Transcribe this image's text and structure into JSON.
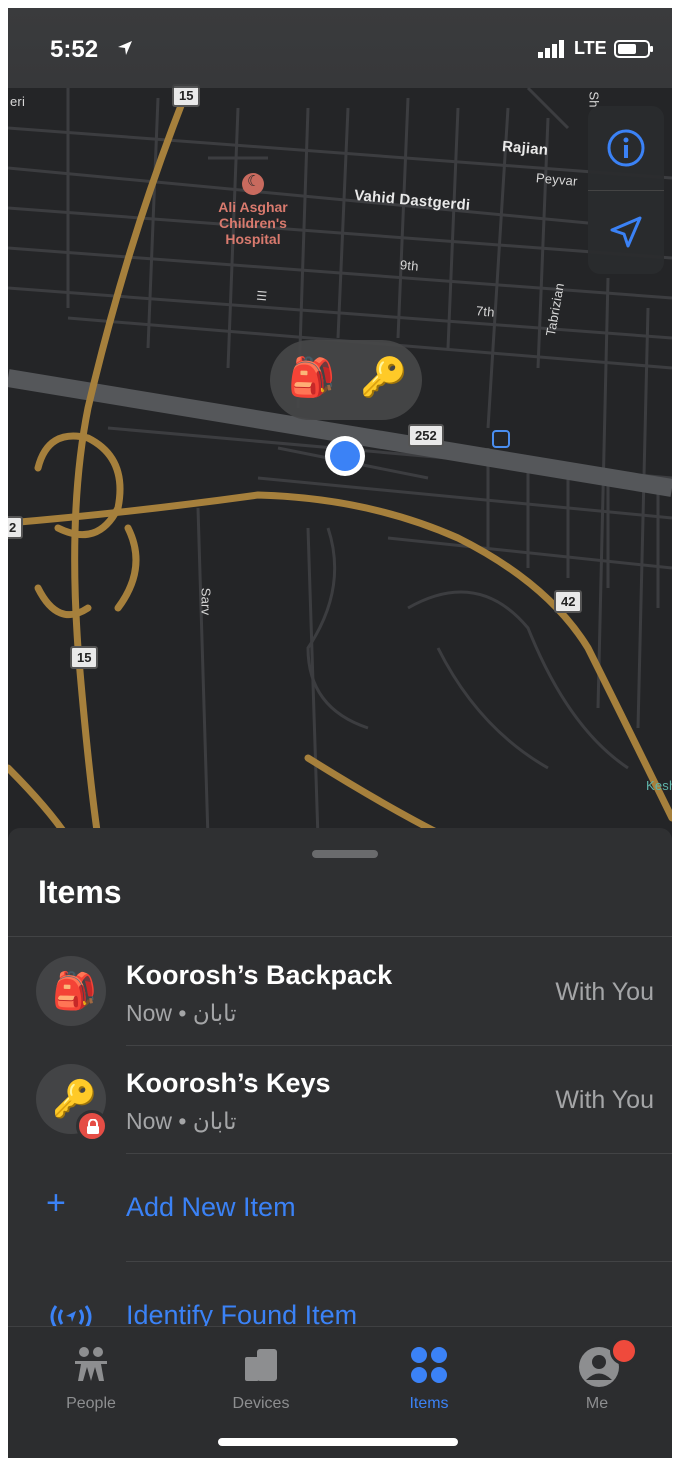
{
  "status_bar": {
    "time": "5:52",
    "network": "LTE"
  },
  "map": {
    "street_labels": {
      "rajian": "Rajian",
      "peyvar": "Peyvar",
      "vahid": "Vahid Dastgerdi",
      "ninth": "9th",
      "seventh": "7th",
      "tabrizian": "Tabrizian",
      "sarv": "Sarv",
      "keshavarz": "Kesh",
      "iii": "III",
      "edge_left_top": "eri",
      "edge_right_top": "Sh",
      "edge_left_mid": "2"
    },
    "hospital": [
      "Ali Asghar",
      "Children's",
      "Hospital"
    ],
    "shields": {
      "top15": "15",
      "r252": "252",
      "r42": "42",
      "left15": "15"
    }
  },
  "sheet": {
    "title": "Items",
    "items": [
      {
        "name": "Koorosh’s Backpack",
        "subtitle": "Now • تابان",
        "status": "With You",
        "emoji": "🎒"
      },
      {
        "name": "Koorosh’s Keys",
        "subtitle": "Now • تابان",
        "status": "With You",
        "emoji": "🔑"
      }
    ],
    "add_label": "Add New Item",
    "identify_label": "Identify Found Item"
  },
  "tabs": [
    {
      "label": "People"
    },
    {
      "label": "Devices"
    },
    {
      "label": "Items"
    },
    {
      "label": "Me"
    }
  ],
  "colors": {
    "accent": "#3b82f6",
    "highway": "#a6803c",
    "badge": "#ef4a3c"
  }
}
